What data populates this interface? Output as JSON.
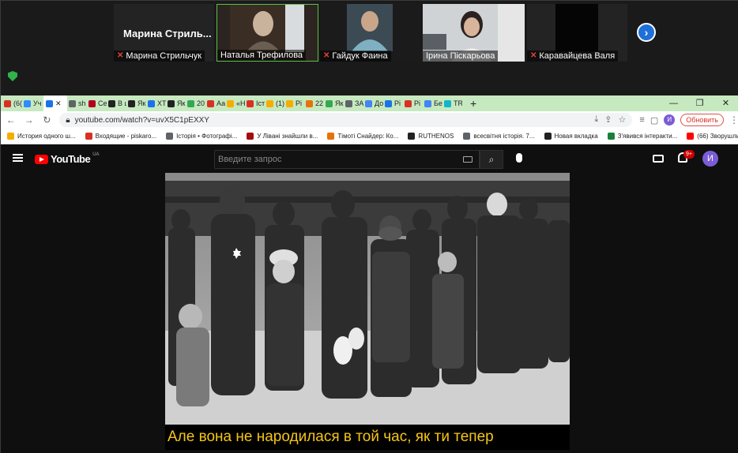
{
  "zoom": {
    "participants": [
      {
        "name": "Марина Стрильчук",
        "label": "Марина Стрильчук",
        "tile_text": "Марина  Стриль...",
        "muted": true,
        "video": false
      },
      {
        "name": "Наталья Трефилова",
        "label": "Наталья Трефилова",
        "muted": false,
        "video": true,
        "active": true
      },
      {
        "name": "Гайдук Фаина",
        "label": "Гайдук Фаина",
        "muted": true,
        "video": true
      },
      {
        "name": "Ірина Піскарьова",
        "label": "Ірина Піскарьова",
        "muted": false,
        "video": true
      },
      {
        "name": "Каравайцева Валя",
        "label": "Каравайцева Валя",
        "muted": true,
        "video": true
      }
    ],
    "next_icon": "chevron-right-icon",
    "security_icon": "shield-check-icon"
  },
  "browser": {
    "tabs": [
      {
        "label": "(6(",
        "icon": "gmail-icon",
        "color": "#d93025"
      },
      {
        "label": "Уч",
        "icon": "zoom-icon",
        "color": "#2d8cff"
      },
      {
        "label": "",
        "icon": "active-tab",
        "color": "#1a73e8",
        "active": true
      },
      {
        "label": "sh",
        "icon": "web-icon",
        "color": "#5f6368"
      },
      {
        "label": "Се",
        "icon": "web-icon",
        "color": "#b00020"
      },
      {
        "label": "В ц",
        "icon": "web-icon",
        "color": "#222222"
      },
      {
        "label": "Як",
        "icon": "web-icon",
        "color": "#222222"
      },
      {
        "label": "ХТ",
        "icon": "web-icon",
        "color": "#1a73e8"
      },
      {
        "label": "Як",
        "icon": "web-icon",
        "color": "#222222"
      },
      {
        "label": "20",
        "icon": "web-icon",
        "color": "#34a853"
      },
      {
        "label": "Аа",
        "icon": "web-icon",
        "color": "#d93025"
      },
      {
        "label": "«Н",
        "icon": "web-icon",
        "color": "#f9ab00"
      },
      {
        "label": "Іст",
        "icon": "web-icon",
        "color": "#d93025"
      },
      {
        "label": "(1)",
        "icon": "web-icon",
        "color": "#f9ab00"
      },
      {
        "label": "Рі",
        "icon": "web-icon",
        "color": "#f9ab00"
      },
      {
        "label": "22",
        "icon": "web-icon",
        "color": "#e8710a"
      },
      {
        "label": "Як",
        "icon": "web-icon",
        "color": "#34a853"
      },
      {
        "label": "ЗА",
        "icon": "web-icon",
        "color": "#5f6368"
      },
      {
        "label": "До",
        "icon": "google-icon",
        "color": "#4285f4"
      },
      {
        "label": "Рі",
        "icon": "web-icon",
        "color": "#1a73e8"
      },
      {
        "label": "Рі",
        "icon": "web-icon",
        "color": "#d93025"
      },
      {
        "label": "Бе",
        "icon": "google-icon",
        "color": "#4285f4"
      },
      {
        "label": "TR",
        "icon": "web-icon",
        "color": "#12b5cb"
      }
    ],
    "url": "youtube.com/watch?v=uvX5C1pEXXY",
    "update_label": "Обновить",
    "profile_initial": "И",
    "bookmarks": [
      {
        "label": "История одного ш...",
        "color": "#f9ab00"
      },
      {
        "label": "Входящие - piskaro...",
        "color": "#d93025"
      },
      {
        "label": "Історія • Фотографі...",
        "color": "#5f6368"
      },
      {
        "label": "У Лівані знайшли в...",
        "color": "#a50e0e"
      },
      {
        "label": "Тімоті Снайдер: Ко...",
        "color": "#e8710a"
      },
      {
        "label": "RUTHENOS",
        "color": "#222222"
      },
      {
        "label": "всесвітня історія. 7...",
        "color": "#5f6368"
      },
      {
        "label": "Новая вкладка",
        "color": "#222222"
      },
      {
        "label": "З'явився інтеракти...",
        "color": "#188038"
      },
      {
        "label": "(66) Зворушливо...",
        "color": "#ff0000"
      }
    ]
  },
  "youtube": {
    "logo_text": "YouTube",
    "region": "UA",
    "search_placeholder": "Введите запрос",
    "notifications_badge": "9+",
    "avatar_initial": "И",
    "subtitle": "Але вона не народилася в той час, як ти тепер"
  }
}
